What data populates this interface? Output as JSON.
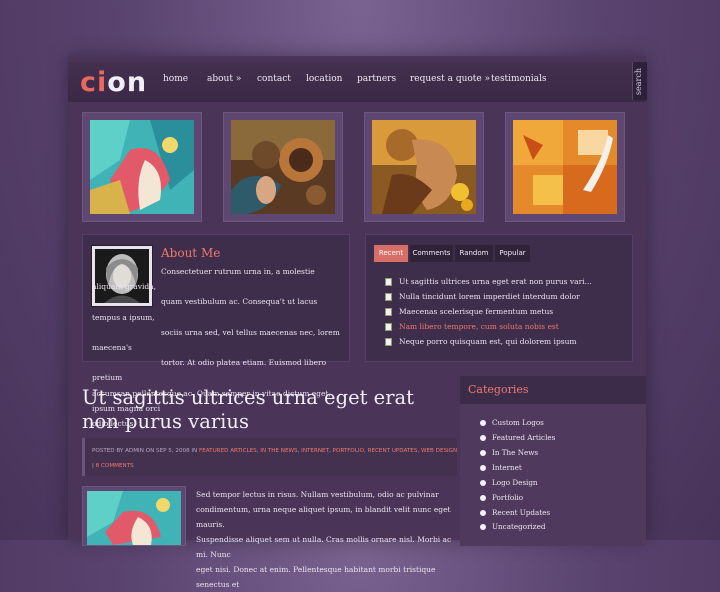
{
  "logo": {
    "part1": "ci",
    "part2": "on"
  },
  "nav": [
    "home",
    "about »",
    "contact",
    "location",
    "partners",
    "request a quote »",
    "testimonials"
  ],
  "search_label": "search",
  "about": {
    "title": "About Me",
    "text_lines": [
      "Consectetuer rutrum urna in, a molestie aliquam gravida,",
      "quam vestibulum ac. Consequa't ut lacus tempus a ipsum,",
      "sociis urna sed, vel tellus maecenas nec, lorem maecena's",
      "tortor. At odio platea etiam. Euismod libero pretium",
      "accumsan pellentesque ac. Quam semper in vitae dictum eget, ipsum magna orci",
      "odio lectus."
    ]
  },
  "tabs": [
    "Recent",
    "Comments",
    "Random",
    "Popular"
  ],
  "recent": [
    {
      "text": "Ut sagittis ultrices urna eget erat non purus vari...",
      "highlight": false
    },
    {
      "text": "Nulla tincidunt lorem imperdiet interdum dolor",
      "highlight": false
    },
    {
      "text": "Maecenas scelerisque fermentum metus",
      "highlight": false
    },
    {
      "text": "Nam libero tempore, cum soluta nobis est",
      "highlight": true
    },
    {
      "text": "Neque porro quisquam est, qui dolorem ipsum",
      "highlight": false
    }
  ],
  "post": {
    "title": "Ut sagittis ultrices urna eget erat non purus varius",
    "posted_by": "POSTED BY",
    "author": "ADMIN",
    "on": "ON SEP 5, 2008 IN",
    "categories": [
      "FEATURED ARTICLES",
      "IN THE NEWS",
      "INTERNET",
      "PORTFOLIO",
      "RECENT UPDATES",
      "WEB DESIGN"
    ],
    "comments": "8 COMMENTS",
    "text_lines": [
      "Sed tempor lectus in risus. Nullam vestibulum, odio ac pulvinar",
      "condimentum, urna neque aliquet ipsum, in blandit velit nunc eget mauris.",
      "Suspendisse aliquet sem ut nulla. Cras mollis ornare nisl. Morbi ac mi. Nunc",
      "eget nisi. Donec at enim. Pellentesque habitant morbi tristique senectus et"
    ]
  },
  "sidebar": {
    "title": "Categories",
    "items": [
      "Custom Logos",
      "Featured Articles",
      "In The News",
      "Internet",
      "Logo Design",
      "Portfolio",
      "Recent Updates",
      "Uncategorized"
    ]
  }
}
